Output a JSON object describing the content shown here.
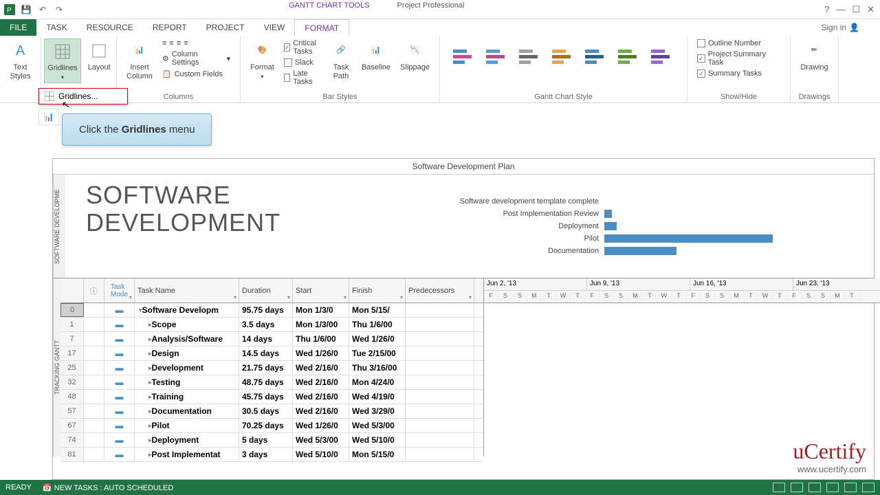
{
  "title": {
    "tool": "GANTT CHART TOOLS",
    "app": "Project Professional"
  },
  "tabs": {
    "file": "FILE",
    "task": "TASK",
    "resource": "RESOURCE",
    "report": "REPORT",
    "project": "PROJECT",
    "view": "VIEW",
    "format": "FORMAT",
    "signin": "Sign in"
  },
  "ribbon": {
    "textstyles": "Text\nStyles",
    "gridlines": "Gridlines",
    "layout": "Layout",
    "insertcol": "Insert\nColumn",
    "colsettings": "Column Settings",
    "customfields": "Custom Fields",
    "columns": "Columns",
    "format": "Format",
    "critical": "Critical Tasks",
    "slack": "Slack",
    "late": "Late Tasks",
    "taskpath": "Task\nPath",
    "baseline": "Baseline",
    "slippage": "Slippage",
    "barstyles": "Bar Styles",
    "ganttstyle": "Gantt Chart Style",
    "outline": "Outline Number",
    "projsum": "Project Summary Task",
    "sumtask": "Summary Tasks",
    "showhide": "Show/Hide",
    "drawing": "Drawing",
    "drawings": "Drawings"
  },
  "menu": {
    "gridlines": "Gridlines..."
  },
  "callout": {
    "pre": "Click the ",
    "bold": "Gridlines",
    "post": " menu"
  },
  "project": {
    "title": "Software Development Plan",
    "big1": "SOFTWARE",
    "big2": "DEVELOPMENT",
    "side1": "SOFTWARE DEVELOPME",
    "side2": "TRACKING GANTT"
  },
  "chart_data": {
    "type": "bar",
    "orientation": "horizontal",
    "categories": [
      "Software development template complete",
      "Post Implementation Review",
      "Deployment",
      "Pilot",
      "Documentation"
    ],
    "values": [
      0,
      3,
      5,
      70,
      30
    ],
    "xlim": [
      0,
      100
    ]
  },
  "columns": {
    "info": "ⓘ",
    "mode": "Task\nMode",
    "name": "Task Name",
    "dur": "Duration",
    "start": "Start",
    "finish": "Finish",
    "pred": "Predecessors"
  },
  "timescale": {
    "weeks": [
      "Jun 2, '13",
      "Jun 9, '13",
      "Jun 16, '13",
      "Jun 23, '13"
    ],
    "days": [
      "F",
      "S",
      "S",
      "M",
      "T",
      "W",
      "T",
      "F",
      "S",
      "S",
      "M",
      "T",
      "W",
      "T",
      "F",
      "S",
      "S",
      "M",
      "T",
      "W",
      "T",
      "F",
      "S",
      "S",
      "M",
      "T"
    ]
  },
  "rows": [
    {
      "n": "0",
      "name": "Software Developm",
      "dur": "95.75 days",
      "start": "Mon 1/3/0",
      "finish": "Mon 5/15/",
      "bold": true,
      "indent": 0,
      "expand": "▾"
    },
    {
      "n": "1",
      "name": "Scope",
      "dur": "3.5 days",
      "start": "Mon 1/3/00",
      "finish": "Thu 1/6/00",
      "bold": true,
      "indent": 1,
      "expand": "▸"
    },
    {
      "n": "7",
      "name": "Analysis/Software",
      "dur": "14 days",
      "start": "Thu 1/6/00",
      "finish": "Wed 1/26/0",
      "bold": true,
      "indent": 1,
      "expand": "▸"
    },
    {
      "n": "17",
      "name": "Design",
      "dur": "14.5 days",
      "start": "Wed 1/26/0",
      "finish": "Tue 2/15/00",
      "bold": true,
      "indent": 1,
      "expand": "▸"
    },
    {
      "n": "25",
      "name": "Development",
      "dur": "21.75 days",
      "start": "Wed 2/16/0",
      "finish": "Thu 3/16/00",
      "bold": true,
      "indent": 1,
      "expand": "▸"
    },
    {
      "n": "32",
      "name": "Testing",
      "dur": "48.75 days",
      "start": "Wed 2/16/0",
      "finish": "Mon 4/24/0",
      "bold": true,
      "indent": 1,
      "expand": "▸"
    },
    {
      "n": "48",
      "name": "Training",
      "dur": "45.75 days",
      "start": "Wed 2/16/0",
      "finish": "Wed 4/19/0",
      "bold": true,
      "indent": 1,
      "expand": "▸"
    },
    {
      "n": "57",
      "name": "Documentation",
      "dur": "30.5 days",
      "start": "Wed 2/16/0",
      "finish": "Wed 3/29/0",
      "bold": true,
      "indent": 1,
      "expand": "▸"
    },
    {
      "n": "67",
      "name": "Pilot",
      "dur": "70.25 days",
      "start": "Wed 1/26/0",
      "finish": "Wed 5/3/00",
      "bold": true,
      "indent": 1,
      "expand": "▸"
    },
    {
      "n": "74",
      "name": "Deployment",
      "dur": "5 days",
      "start": "Wed 5/3/00",
      "finish": "Wed 5/10/0",
      "bold": true,
      "indent": 1,
      "expand": "▸"
    },
    {
      "n": "81",
      "name": "Post Implementat",
      "dur": "3 days",
      "start": "Wed 5/10/0",
      "finish": "Mon 5/15/0",
      "bold": true,
      "indent": 1,
      "expand": "▸"
    }
  ],
  "status": {
    "ready": "READY",
    "newtasks": "NEW TASKS : AUTO SCHEDULED"
  },
  "watermark": {
    "brand": "uCertify",
    "url": "www.ucertify.com"
  }
}
